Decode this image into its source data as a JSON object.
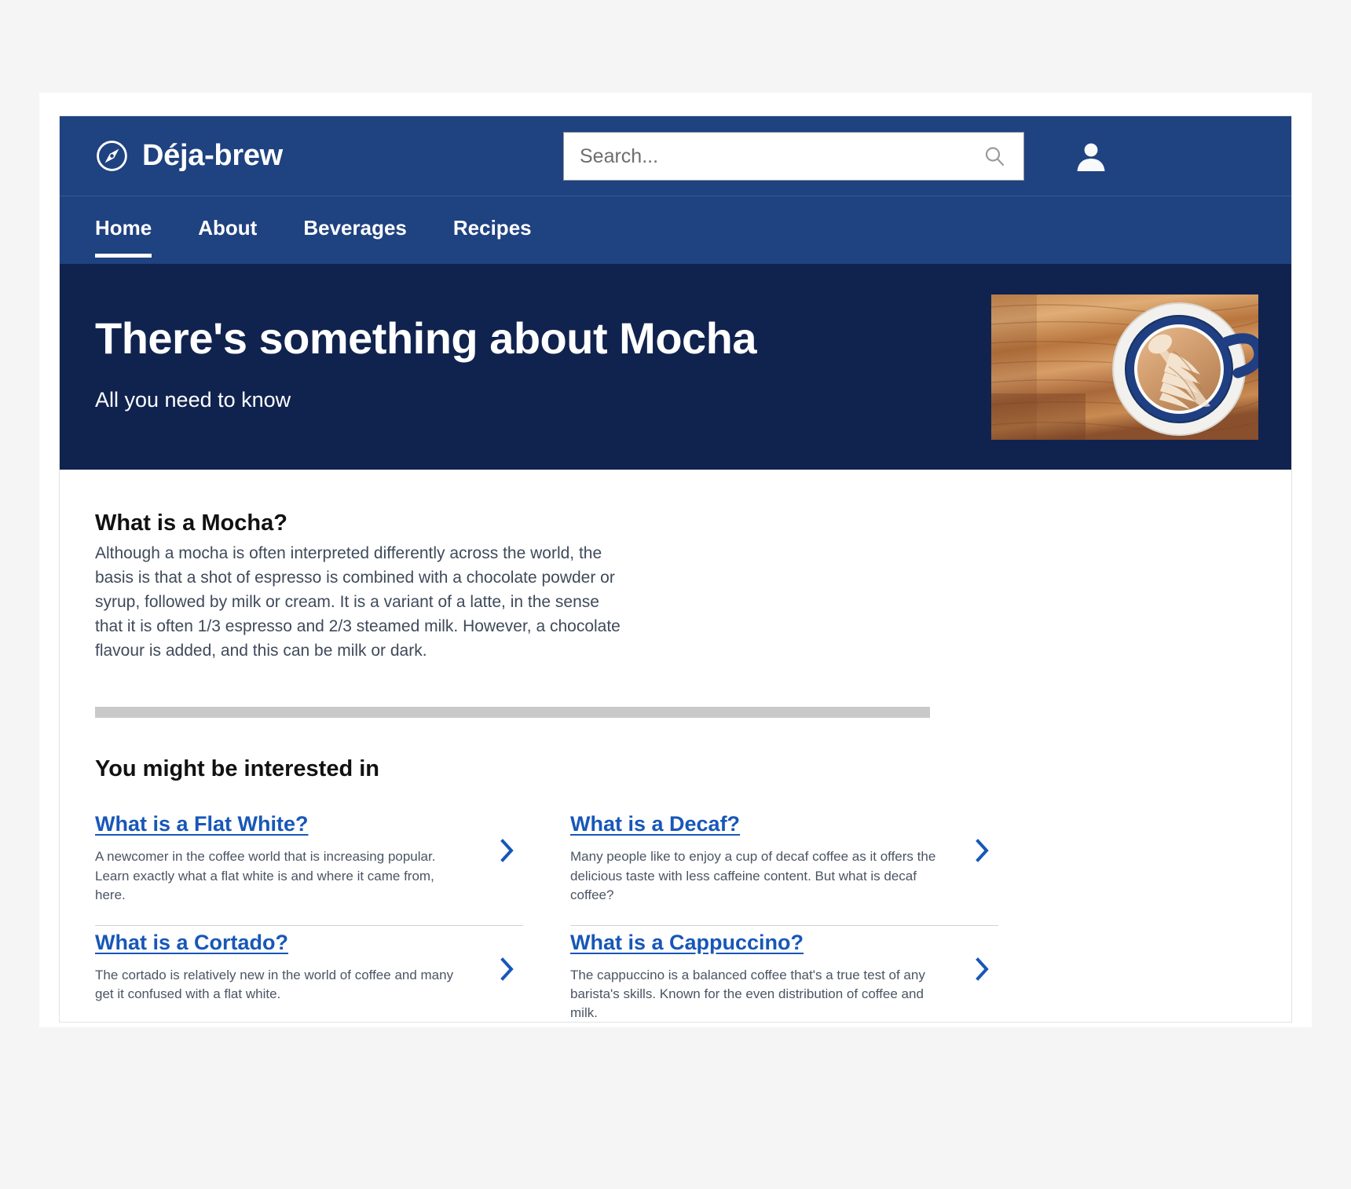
{
  "brand": {
    "name": "Déja-brew",
    "icon": "compass-icon",
    "bar_color": "#1f4280"
  },
  "search": {
    "placeholder": "Search...",
    "value": "",
    "icon": "search-icon"
  },
  "account": {
    "icon": "person-icon",
    "label": "Account"
  },
  "nav": {
    "items": [
      {
        "label": "Home",
        "active": true
      },
      {
        "label": "About",
        "active": false
      },
      {
        "label": "Beverages",
        "active": false
      },
      {
        "label": "Recipes",
        "active": false
      }
    ]
  },
  "hero": {
    "title": "There's something about Mocha",
    "subtitle": "All you need to know",
    "background_color": "#10234f",
    "image_alt": "latte-art-coffee-cup-on-wooden-table"
  },
  "article": {
    "heading": "What is a Mocha?",
    "paragraph": "Although a mocha is often interpreted differently across the world, the basis is that a shot of espresso is combined with a chocolate powder or syrup, followed by milk or cream. It is a variant of a latte, in the sense that it is often 1/3 espresso and 2/3 steamed milk. However, a chocolate flavour is added, and this can be milk or dark."
  },
  "related": {
    "heading": "You might be interested in",
    "chevron_icon": "chevron-right-icon",
    "link_color": "#1757b8",
    "cards": [
      {
        "title": "What is a Flat White?",
        "description": "A newcomer in the coffee world that is increasing popular. Learn exactly what a flat white is and where it came from, here."
      },
      {
        "title": "What is a Decaf?",
        "description": "Many people like to enjoy a cup of decaf coffee as it offers the delicious taste with less caffeine content. But what is decaf coffee?"
      },
      {
        "title": "What is a Cortado?",
        "description": "The cortado is relatively new in the world of coffee and many get it confused with a flat white."
      },
      {
        "title": "What is a Cappuccino?",
        "description": "The cappuccino is a balanced coffee that's a true test of any barista's skills. Known for the even distribution of coffee and milk."
      }
    ]
  }
}
